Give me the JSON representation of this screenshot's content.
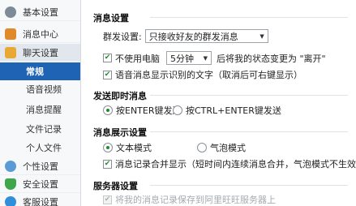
{
  "sidebar": {
    "categories": [
      {
        "label": "基本设置",
        "icon": "gear-icon"
      },
      {
        "label": "消息中心",
        "icon": "mail-icon"
      },
      {
        "label": "聊天设置",
        "icon": "chat-icon"
      },
      {
        "label": "个性设置",
        "icon": "person-icon"
      },
      {
        "label": "安全设置",
        "icon": "shield-icon"
      },
      {
        "label": "客服设置",
        "icon": "headset-icon"
      }
    ],
    "subitems": [
      "常规",
      "语音视频",
      "消息提醒",
      "文件记录",
      "个人文件"
    ],
    "selected_sub": "常规"
  },
  "main": {
    "message_settings": {
      "title": "消息设置",
      "group_label": "群发设置:",
      "group_value": "只接收好友的群发消息",
      "idle_checkbox_label": "不使用电脑",
      "idle_minutes": "5分钟",
      "idle_suffix": "后将我的状态变更为 \"离开\"",
      "voice_checkbox_label": "语音消息显示识别的文字（取消后可右键显示）"
    },
    "send_settings": {
      "title": "发送即时消息",
      "option_enter": "按ENTER键发送",
      "option_ctrl_enter": "按CTRL+ENTER键发送"
    },
    "display_settings": {
      "title": "消息展示设置",
      "option_text": "文本模式",
      "option_bubble": "气泡模式",
      "merge_checkbox_label": "消息记录合并显示（短时间内连续消息合并，气泡模式不生效）"
    },
    "server_settings": {
      "title": "服务器设置",
      "save_checkbox_label": "将我的消息记录保存到阿里旺旺服务器上"
    }
  },
  "colors": {
    "selected_nav": "#1f63b5",
    "check_green": "#1d8f2a"
  }
}
